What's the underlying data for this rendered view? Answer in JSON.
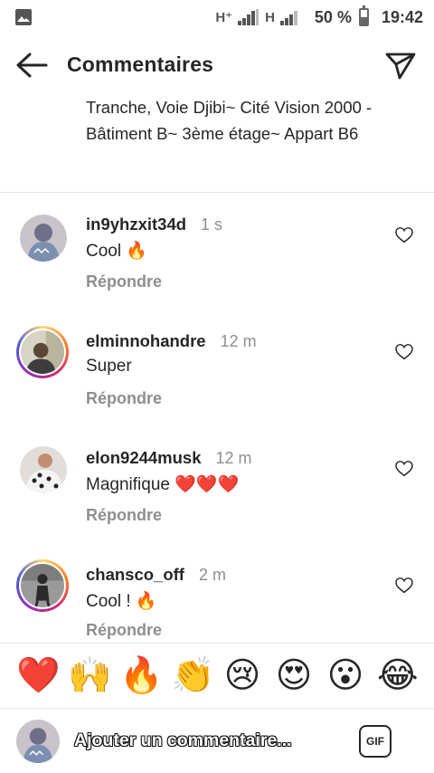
{
  "status_bar": {
    "network_1": "H⁺",
    "network_2": "H",
    "battery": "50 %",
    "battery_level": 0.5,
    "time": "19:42"
  },
  "header": {
    "title": "Commentaires"
  },
  "caption": {
    "text": "Tranche, Voie Djibi~ Cité Vision 2000 - Bâtiment B~ 3ème étage~ Appart B6"
  },
  "comments": [
    {
      "username": "in9yhzxit34d",
      "time": "1 s",
      "text": "Cool 🔥",
      "reply": "Répondre",
      "story_ring": false
    },
    {
      "username": "elminnohandre",
      "time": "12 m",
      "text": "Super",
      "reply": "Répondre",
      "story_ring": true
    },
    {
      "username": "elon9244musk",
      "time": "12 m",
      "text": "Magnifique ❤️❤️❤️",
      "reply": "Répondre",
      "story_ring": false
    },
    {
      "username": "chansco_off",
      "time": "2 m",
      "text": "Cool ! 🔥",
      "reply": "Répondre",
      "story_ring": true
    }
  ],
  "emoji_bar": [
    "❤️",
    "🙌",
    "🔥",
    "👏",
    "😢",
    "😍",
    "😮",
    "😂"
  ],
  "input": {
    "placeholder": "Ajouter un commentaire...",
    "gif_label": "GIF"
  },
  "colors": {
    "text": "#262626",
    "secondary": "#8e8e8e",
    "divider": "#e0e0e0"
  }
}
